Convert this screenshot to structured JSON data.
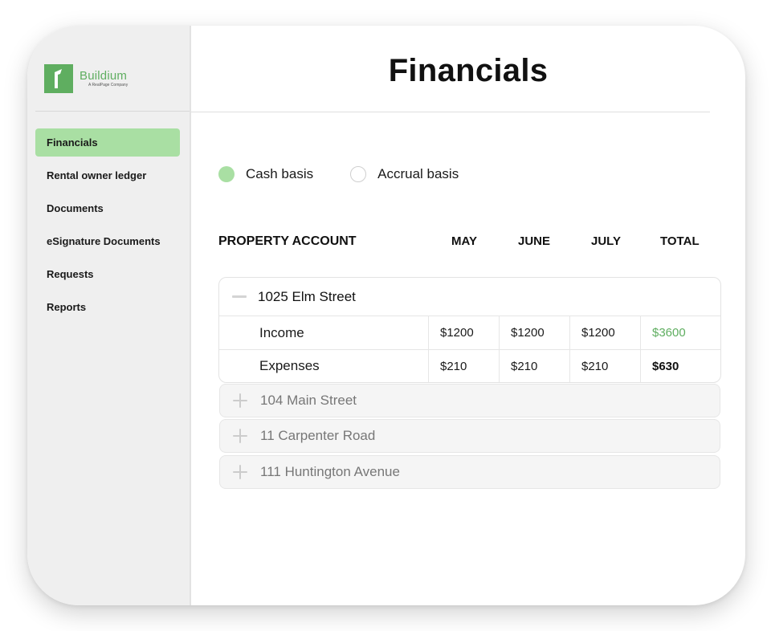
{
  "brand": {
    "name": "Buildium",
    "tagline": "A RealPage Company",
    "accent_color": "#5fae60",
    "active_bg": "#a9dfa3"
  },
  "sidebar": {
    "items": [
      {
        "label": "Financials",
        "active": true
      },
      {
        "label": "Rental owner ledger",
        "active": false
      },
      {
        "label": "Documents",
        "active": false
      },
      {
        "label": "eSignature Documents",
        "active": false
      },
      {
        "label": "Requests",
        "active": false
      },
      {
        "label": "Reports",
        "active": false
      }
    ]
  },
  "main": {
    "title": "Financials",
    "basis_options": [
      {
        "label": "Cash basis",
        "selected": true
      },
      {
        "label": "Accrual basis",
        "selected": false
      }
    ],
    "table": {
      "headers": {
        "property": "PROPERTY ACCOUNT",
        "may": "MAY",
        "june": "JUNE",
        "july": "JULY",
        "total": "TOTAL"
      },
      "expanded": {
        "name": "1025 Elm Street",
        "icon": "minus-icon",
        "rows": [
          {
            "label": "Income",
            "may": "$1200",
            "june": "$1200",
            "july": "$1200",
            "total": "$3600"
          },
          {
            "label": "Expenses",
            "may": "$210",
            "june": "$210",
            "july": "$210",
            "total": "$630"
          }
        ]
      },
      "collapsed": [
        {
          "name": "104 Main Street",
          "icon": "plus-icon"
        },
        {
          "name": "11 Carpenter Road",
          "icon": "plus-icon"
        },
        {
          "name": "111 Huntington Avenue",
          "icon": "plus-icon"
        }
      ]
    }
  }
}
